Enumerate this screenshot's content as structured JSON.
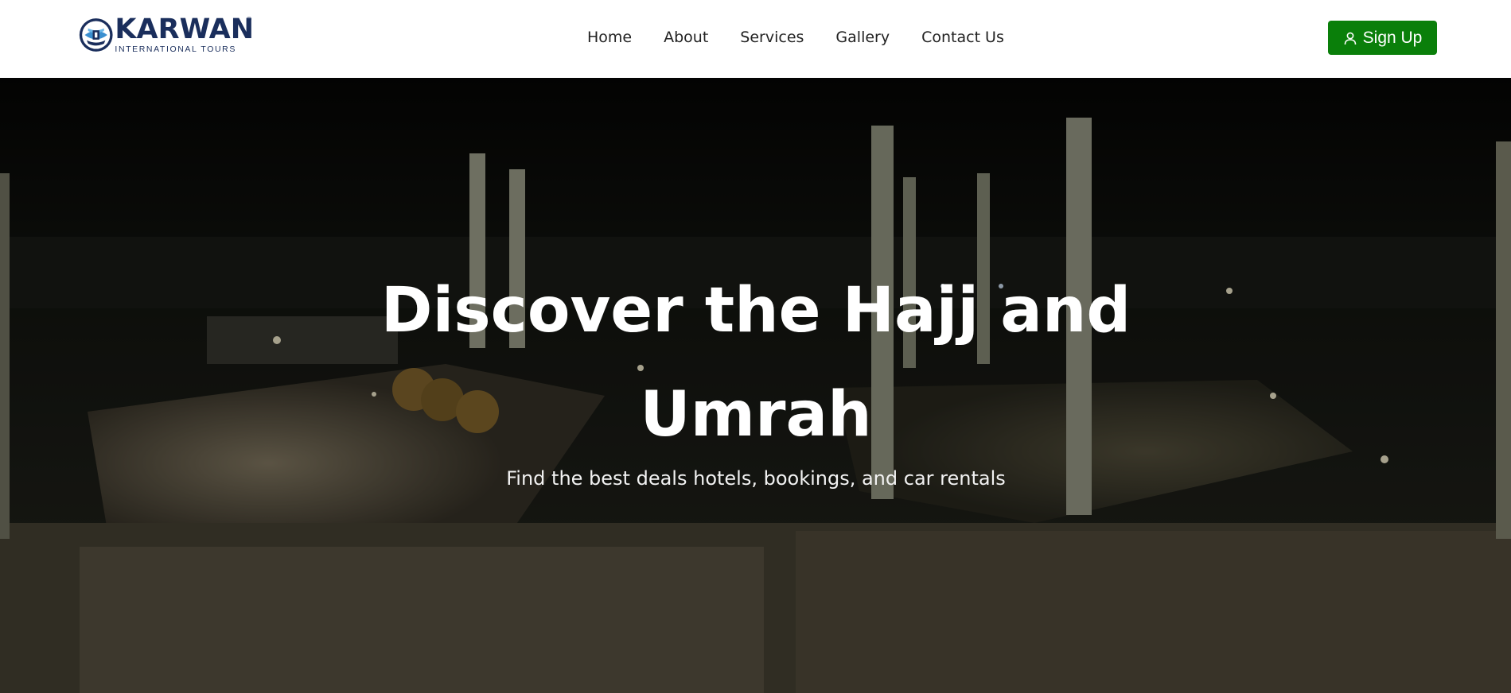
{
  "brand": {
    "name": "KARWAN",
    "tagline": "INTERNATIONAL TOURS",
    "registered_mark": "®",
    "primary_color": "#1a2e5c"
  },
  "nav": {
    "items": [
      {
        "label": "Home"
      },
      {
        "label": "About"
      },
      {
        "label": "Services"
      },
      {
        "label": "Gallery"
      },
      {
        "label": "Contact Us"
      }
    ]
  },
  "signup": {
    "label": "Sign Up",
    "icon": "user-icon",
    "color": "#0a7f0a"
  },
  "hero": {
    "title": "Discover the Hajj and Umrah",
    "subtitle": "Find the best deals hotels, bookings, and car rentals"
  }
}
